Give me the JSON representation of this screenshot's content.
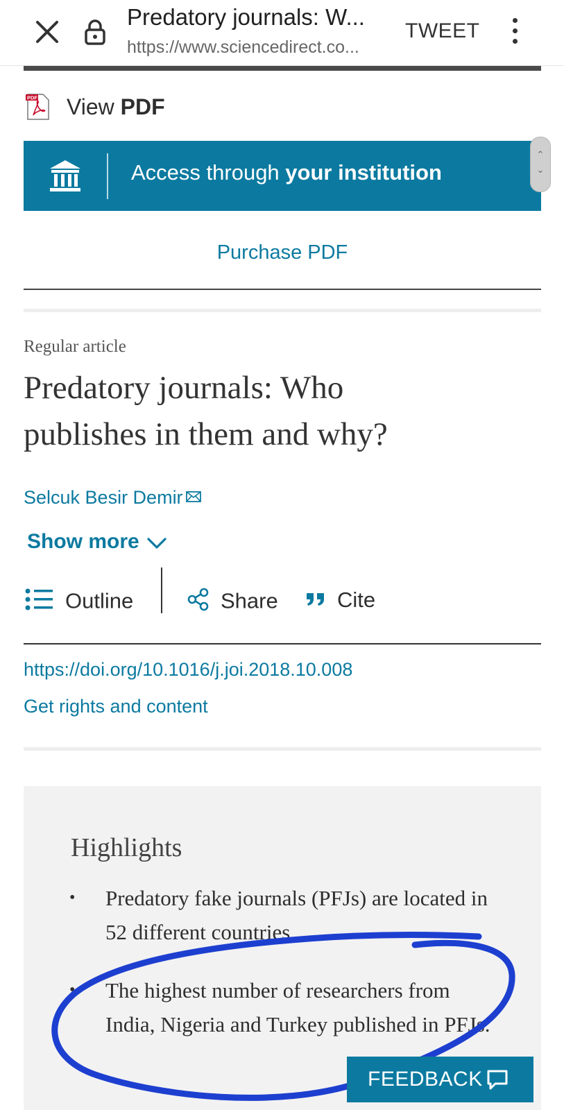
{
  "browser": {
    "title": "Predatory journals: W...",
    "url": "https://www.sciencedirect.co...",
    "tweet_label": "TWEET"
  },
  "pdf": {
    "view_label_prefix": "View ",
    "view_label_bold": "PDF",
    "icon_text": "PDF"
  },
  "access": {
    "text_prefix": "Access through ",
    "text_bold": "your institution"
  },
  "purchase_label": "Purchase PDF",
  "article": {
    "type": "Regular article",
    "title_line1": "Predatory journals: Who",
    "title_line2": "publishes in them and why?",
    "author": "Selcuk Besir Demir",
    "show_more": "Show more"
  },
  "toolbar": {
    "outline": "Outline",
    "share": "Share",
    "cite": "Cite"
  },
  "doi_link": "https://doi.org/10.1016/j.joi.2018.10.008",
  "rights_link": "Get rights and content",
  "highlights": {
    "heading": "Highlights",
    "bullet": "•",
    "items": [
      "Predatory fake journals (PFJs) are located in 52 different countries.",
      "The highest number of researchers from India, Nigeria and Turkey published in PFJs."
    ]
  },
  "feedback_label": "FEEDBACK",
  "colors": {
    "accent": "#0c7aa0",
    "annotation_ink": "#1d3fd0",
    "highlights_bg": "#f2f2f2"
  }
}
